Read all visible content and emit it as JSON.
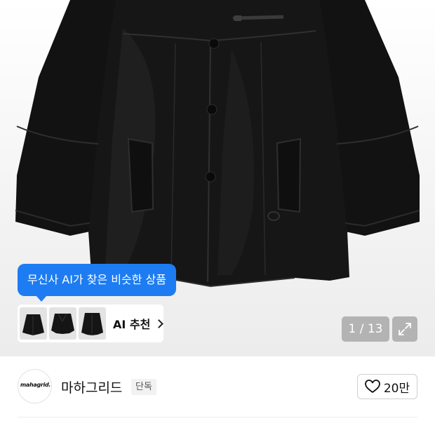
{
  "ai_recommendation": {
    "tooltip": "무신사 AI가 찾은 비슷한 상품",
    "label": "AI 추천",
    "thumbnail_icons": [
      "jacket-thumb-icon",
      "jacket-thumb-icon",
      "jacket-thumb-icon"
    ]
  },
  "gallery": {
    "pager": "1 / 13",
    "expand_icon": "expand-icon"
  },
  "seller": {
    "logo_text": "mahagrid.",
    "name": "마하그리드",
    "badge": "단독",
    "like_icon": "heart-outline-icon",
    "like_count": "20만"
  },
  "colors": {
    "accent": "#1d7cf2",
    "pager_bg": "#b3b3b3",
    "badge_bg": "#f2f2f2"
  }
}
